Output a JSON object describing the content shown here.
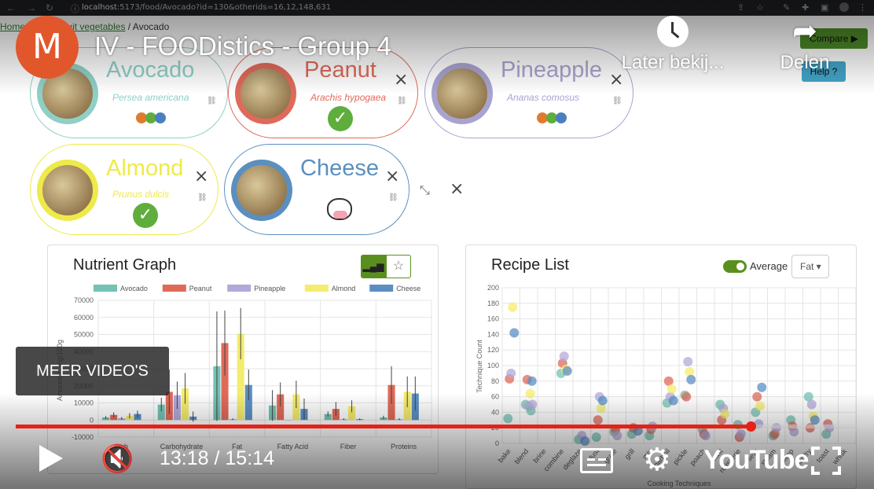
{
  "browser": {
    "url_host": "localhost",
    "url_path": ":5173/food/Avocado?id=130&otherids=16,12,148,631"
  },
  "breadcrumb": {
    "home": "Home",
    "category": "bles",
    "sub": "Fruit vegetables",
    "current": "Avocado"
  },
  "video": {
    "channel_initial": "M",
    "title": "IV - FOODistics - Group 4",
    "watch_later": "Later bekij...",
    "share": "Delen",
    "more_videos": "MEER VIDEO'S",
    "time_current": "13:18",
    "time_total": "15:14",
    "progress": 0.874,
    "brand": "YouTube"
  },
  "app_buttons": {
    "compare": "Compare ▶",
    "help": "Help ?"
  },
  "foods": [
    {
      "name": "Avocado",
      "scientific": "Persea americana",
      "color": "#8fcfc6",
      "badge": "tag"
    },
    {
      "name": "Peanut",
      "scientific": "Arachis hypogaea",
      "color": "#e06a5a",
      "badge": "check"
    },
    {
      "name": "Pineapple",
      "scientific": "Ananas comosus",
      "color": "#a9a3cf",
      "badge": "tag"
    },
    {
      "name": "Almond",
      "scientific": "Prunus dulcis",
      "color": "#eeea4a",
      "badge": "check"
    },
    {
      "name": "Cheese",
      "scientific": "",
      "color": "#5a8fc0",
      "badge": "cow"
    }
  ],
  "nutrient_graph": {
    "title": "Nutrient Graph",
    "legend": [
      "Avocado",
      "Peanut",
      "Pineapple",
      "Almond",
      "Cheese"
    ],
    "colors": [
      "#74c2b4",
      "#e06a5a",
      "#b3a9d9",
      "#f4ec6e",
      "#5b8fc4"
    ],
    "y_ticks": [
      "70000",
      "60000",
      "50000",
      "40000",
      "30000",
      "20000",
      "10000",
      "0",
      "-10000"
    ],
    "y_label": "Amount in mg/100g",
    "categories": [
      "h",
      "Carbohydrate",
      "Fat",
      "Fatty Acid",
      "Fiber",
      "Proteins"
    ],
    "values": [
      [
        1500,
        3000,
        1000,
        2500,
        3500
      ],
      [
        9000,
        16500,
        14500,
        18500,
        2000
      ],
      [
        31500,
        45000,
        500,
        50500,
        20500
      ],
      [
        8500,
        15000,
        0,
        15000,
        6500
      ],
      [
        3500,
        6500,
        500,
        8000,
        500
      ],
      [
        1500,
        20500,
        500,
        16500,
        15500
      ]
    ],
    "errors": [
      [
        800,
        1500,
        800,
        1500,
        2000
      ],
      [
        4000,
        13000,
        8000,
        9000,
        3000
      ],
      [
        32000,
        19000,
        500,
        15000,
        9000
      ],
      [
        9000,
        7000,
        0,
        8000,
        6000
      ],
      [
        1500,
        4000,
        500,
        3500,
        500
      ],
      [
        1000,
        11000,
        500,
        9000,
        10000
      ]
    ]
  },
  "recipe_list": {
    "title": "Recipe List",
    "toggle_label": "Average",
    "dropdown": "Fat",
    "y_ticks": [
      "200",
      "180",
      "160",
      "140",
      "120",
      "100",
      "80",
      "60",
      "40",
      "20",
      "0"
    ],
    "y_label": "Technique Count",
    "x_label": "Cooking Techniques",
    "x_labels": [
      "bake",
      "blend",
      "brine",
      "combine",
      "deglaze",
      "dust",
      "grate",
      "grill",
      "mix",
      "parboil",
      "pickle",
      "poach",
      "roast",
      "rotisserie",
      "sear",
      "steam",
      "steep",
      "stir-fry",
      "toast",
      "whisk"
    ],
    "colors": [
      "#74c2b4",
      "#e06a5a",
      "#b3a9d9",
      "#f4ec6e",
      "#5b8fc4"
    ],
    "points": [
      [
        1,
        0,
        32
      ],
      [
        1,
        1,
        83
      ],
      [
        1,
        2,
        90
      ],
      [
        1,
        3,
        175
      ],
      [
        1,
        4,
        142
      ],
      [
        2,
        0,
        50
      ],
      [
        2,
        1,
        82
      ],
      [
        2,
        2,
        48
      ],
      [
        2,
        3,
        64
      ],
      [
        2,
        4,
        80
      ],
      [
        2.3,
        0,
        42
      ],
      [
        2.2,
        2,
        50
      ],
      [
        4,
        0,
        90
      ],
      [
        4,
        1,
        103
      ],
      [
        4,
        2,
        112
      ],
      [
        4,
        3,
        95
      ],
      [
        4,
        4,
        93
      ],
      [
        5,
        0,
        5
      ],
      [
        5,
        2,
        10
      ],
      [
        5,
        4,
        3
      ],
      [
        6,
        0,
        8
      ],
      [
        6,
        1,
        30
      ],
      [
        6,
        2,
        60
      ],
      [
        6,
        3,
        45
      ],
      [
        6,
        4,
        55
      ],
      [
        7,
        0,
        15
      ],
      [
        7,
        1,
        18
      ],
      [
        7,
        2,
        10
      ],
      [
        8,
        0,
        12
      ],
      [
        8,
        1,
        20
      ],
      [
        8,
        4,
        16
      ],
      [
        9,
        0,
        10
      ],
      [
        9,
        1,
        18
      ],
      [
        9,
        2,
        22
      ],
      [
        10,
        0,
        52
      ],
      [
        10,
        1,
        80
      ],
      [
        10,
        2,
        60
      ],
      [
        10,
        3,
        70
      ],
      [
        10,
        4,
        55
      ],
      [
        11,
        0,
        62
      ],
      [
        11,
        1,
        60
      ],
      [
        11,
        2,
        105
      ],
      [
        11,
        3,
        92
      ],
      [
        11,
        4,
        82
      ],
      [
        12,
        0,
        18
      ],
      [
        12,
        1,
        12
      ],
      [
        12,
        2,
        10
      ],
      [
        13,
        0,
        50
      ],
      [
        13,
        1,
        30
      ],
      [
        13,
        2,
        45
      ],
      [
        13,
        3,
        38
      ],
      [
        14,
        0,
        24
      ],
      [
        14,
        1,
        8
      ],
      [
        14,
        2,
        12
      ],
      [
        15,
        0,
        40
      ],
      [
        15,
        1,
        60
      ],
      [
        15,
        2,
        25
      ],
      [
        15,
        3,
        48
      ],
      [
        15,
        4,
        72
      ],
      [
        16,
        0,
        10
      ],
      [
        16,
        1,
        12
      ],
      [
        16,
        2,
        20
      ],
      [
        17,
        0,
        30
      ],
      [
        17,
        1,
        22
      ],
      [
        17,
        2,
        15
      ],
      [
        18,
        0,
        60
      ],
      [
        18,
        1,
        20
      ],
      [
        18,
        2,
        50
      ],
      [
        18,
        3,
        35
      ],
      [
        18,
        4,
        30
      ],
      [
        19,
        0,
        12
      ],
      [
        19,
        1,
        25
      ],
      [
        19,
        2,
        20
      ]
    ]
  }
}
